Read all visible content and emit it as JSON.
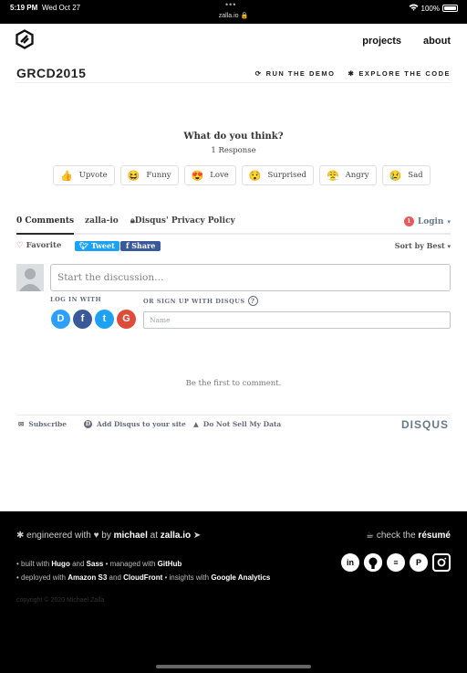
{
  "status": {
    "time": "5:19 PM",
    "date": "Wed Oct 27",
    "url": "zalla.io",
    "battery": "100%"
  },
  "header": {
    "nav": [
      "projects",
      "about"
    ],
    "title": "GRCD2015",
    "run_demo": "RUN THE DEMO",
    "explore": "EXPLORE THE CODE"
  },
  "reactions": {
    "question": "What do you think?",
    "responses": "1 Response",
    "items": [
      {
        "emoji": "👍",
        "label": "Upvote"
      },
      {
        "emoji": "😆",
        "label": "Funny"
      },
      {
        "emoji": "😍",
        "label": "Love"
      },
      {
        "emoji": "😯",
        "label": "Surprised"
      },
      {
        "emoji": "😤",
        "label": "Angry"
      },
      {
        "emoji": "😢",
        "label": "Sad"
      }
    ]
  },
  "disqus": {
    "tab_comments": "0 Comments",
    "tab_site": "zalla-io",
    "tab_privacy": "Disqus' Privacy Policy",
    "login_count": "1",
    "login": "Login",
    "favorite": "Favorite",
    "tweet": "Tweet",
    "share": "Share",
    "sort": "Sort by Best",
    "compose_placeholder": "Start the discussion…",
    "login_with": "LOG IN WITH",
    "signup_with": "OR SIGN UP WITH DISQUS",
    "name_placeholder": "Name",
    "empty": "Be the first to comment.",
    "subscribe": "Subscribe",
    "add_disqus": "Add Disqus to your site",
    "do_not_sell": "Do Not Sell My Data",
    "brand": "DISQUS"
  },
  "footer": {
    "engineered": "engineered with",
    "by": "by",
    "author": "michael",
    "at": "at",
    "site": "zalla.io",
    "check": "check the",
    "resume": "résumé",
    "built_prefix": "• built with",
    "hugo": "Hugo",
    "and1": "and",
    "sass": "Sass",
    "managed": "• managed with",
    "github": "GitHub",
    "deployed_prefix": "• deployed with",
    "s3": "Amazon S3",
    "and2": "and",
    "cloudfront": "CloudFront",
    "insights": "• insights with",
    "ga": "Google Analytics",
    "copyright": "copyright © 2020 Michael Zalla"
  }
}
